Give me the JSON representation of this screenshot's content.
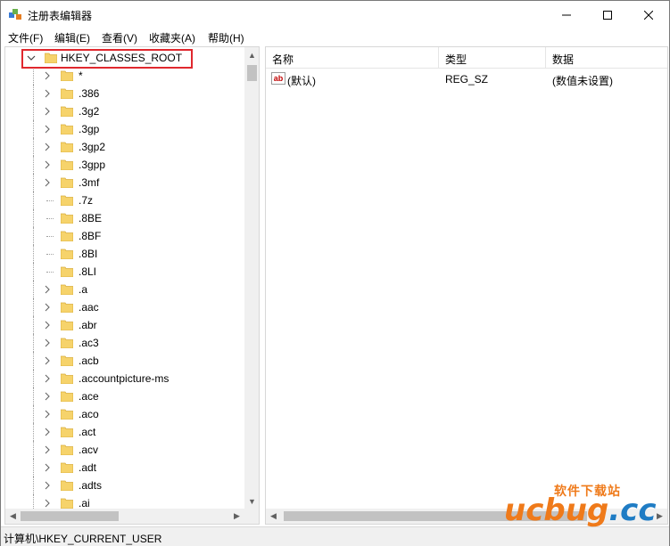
{
  "window": {
    "title": "注册表编辑器",
    "controls": {
      "minimize": "—",
      "maximize": "☐",
      "close": "✕"
    }
  },
  "menu": [
    "文件(F)",
    "编辑(E)",
    "查看(V)",
    "收藏夹(A)",
    "帮助(H)"
  ],
  "tree": {
    "root": "HKEY_CLASSES_ROOT",
    "items": [
      {
        "label": "*",
        "expandable": true
      },
      {
        "label": ".386",
        "expandable": true
      },
      {
        "label": ".3g2",
        "expandable": true
      },
      {
        "label": ".3gp",
        "expandable": true
      },
      {
        "label": ".3gp2",
        "expandable": true
      },
      {
        "label": ".3gpp",
        "expandable": true
      },
      {
        "label": ".3mf",
        "expandable": true
      },
      {
        "label": ".7z",
        "expandable": false
      },
      {
        "label": ".8BE",
        "expandable": false
      },
      {
        "label": ".8BF",
        "expandable": false
      },
      {
        "label": ".8BI",
        "expandable": false
      },
      {
        "label": ".8LI",
        "expandable": false
      },
      {
        "label": ".a",
        "expandable": true
      },
      {
        "label": ".aac",
        "expandable": true
      },
      {
        "label": ".abr",
        "expandable": true
      },
      {
        "label": ".ac3",
        "expandable": true
      },
      {
        "label": ".acb",
        "expandable": true
      },
      {
        "label": ".accountpicture-ms",
        "expandable": true
      },
      {
        "label": ".ace",
        "expandable": true
      },
      {
        "label": ".aco",
        "expandable": true
      },
      {
        "label": ".act",
        "expandable": true
      },
      {
        "label": ".acv",
        "expandable": true
      },
      {
        "label": ".adt",
        "expandable": true
      },
      {
        "label": ".adts",
        "expandable": true
      },
      {
        "label": ".ai",
        "expandable": true
      }
    ]
  },
  "list": {
    "columns": [
      "名称",
      "类型",
      "数据"
    ],
    "rows": [
      {
        "name": "(默认)",
        "type": "REG_SZ",
        "data": "(数值未设置)"
      }
    ]
  },
  "status": "计算机\\HKEY_CURRENT_USER",
  "watermark": {
    "site": "软件下载站",
    "brand_orange": "ucbug",
    "brand_blue": ".cc"
  },
  "colors": {
    "highlight": "#e0282e",
    "folder": "#f6d36b",
    "accent_orange": "#ef7a1a",
    "accent_blue": "#1f7cc4"
  }
}
